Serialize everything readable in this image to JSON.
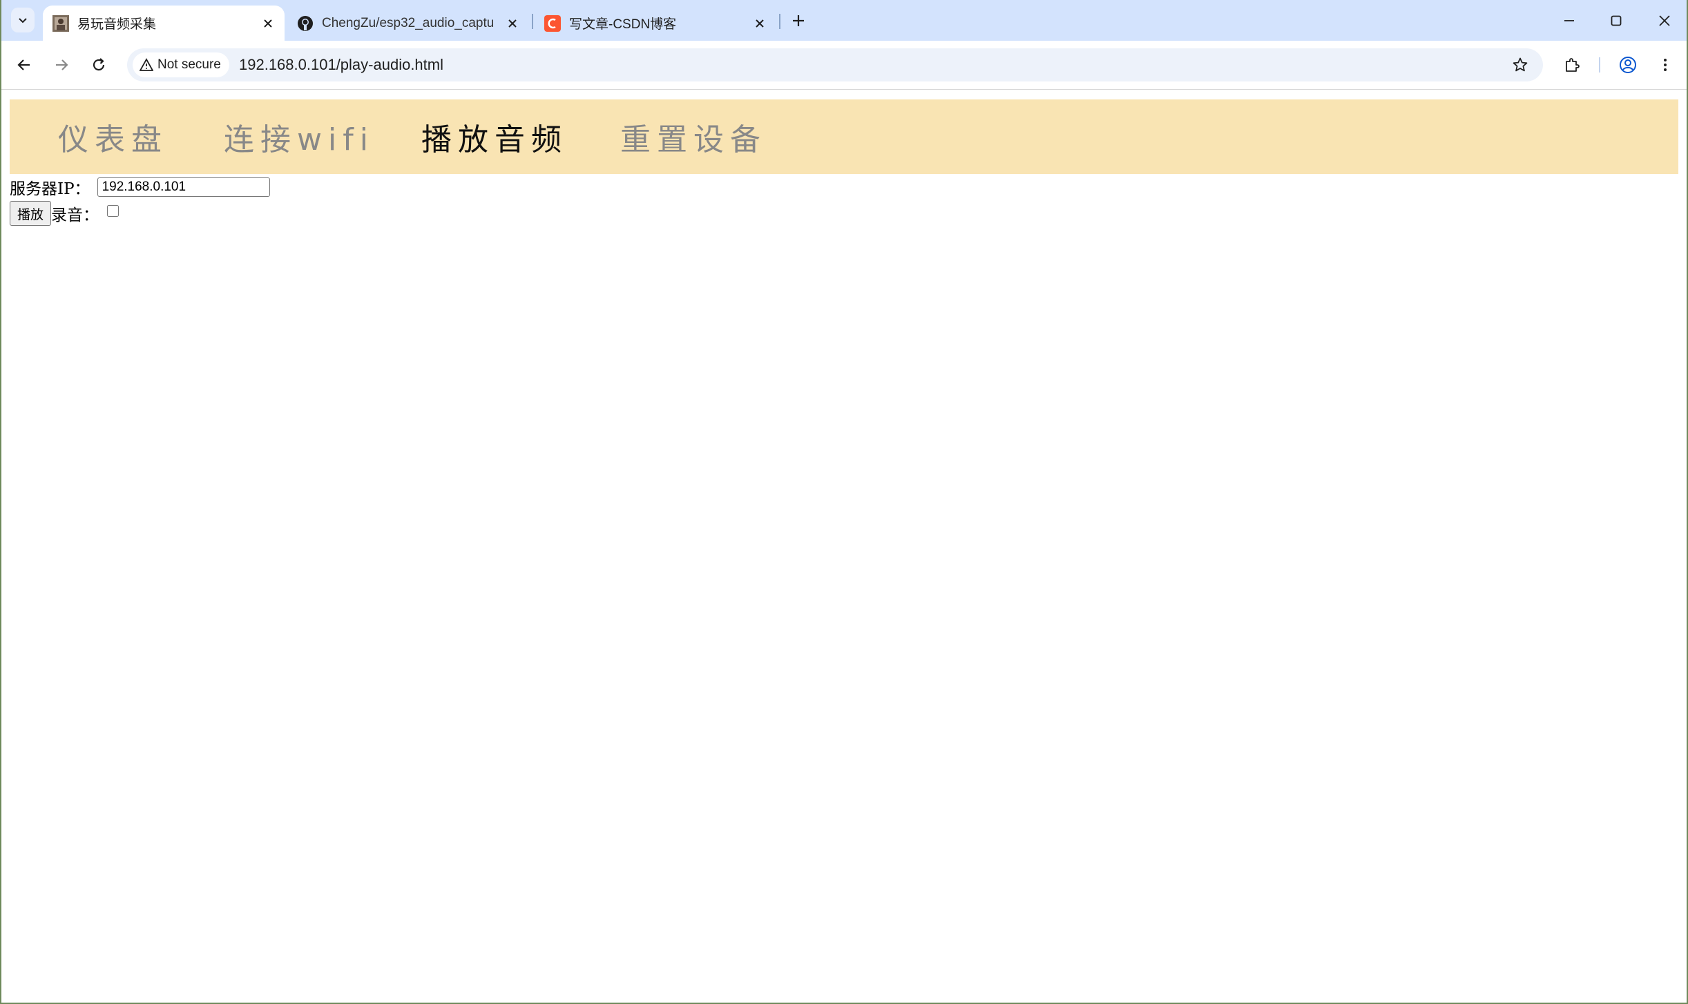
{
  "browser": {
    "tabs": [
      {
        "title": "易玩音频采集",
        "active": true,
        "favicon": "photo-avatar-favicon"
      },
      {
        "title": "ChengZu/esp32_audio_captu",
        "active": false,
        "favicon": "github-icon"
      },
      {
        "title": "写文章-CSDN博客",
        "active": false,
        "favicon": "csdn-icon"
      }
    ],
    "security_label": "Not secure",
    "url": "192.168.0.101/play-audio.html"
  },
  "page": {
    "nav": [
      {
        "label": "仪表盘",
        "active": false
      },
      {
        "label": "连接wifi",
        "active": false
      },
      {
        "label": "播放音频",
        "active": true
      },
      {
        "label": "重置设备",
        "active": false
      }
    ],
    "server_ip_label": "服务器IP：",
    "server_ip_value": "192.168.0.101",
    "play_button_label": "播放",
    "record_label": "录音：",
    "record_checked": false
  },
  "colors": {
    "tabstrip": "#d3e3fd",
    "nav_background": "#f9e4b3",
    "nav_inactive": "#888888",
    "nav_active": "#111111",
    "csdn_brand": "#fc5531"
  }
}
